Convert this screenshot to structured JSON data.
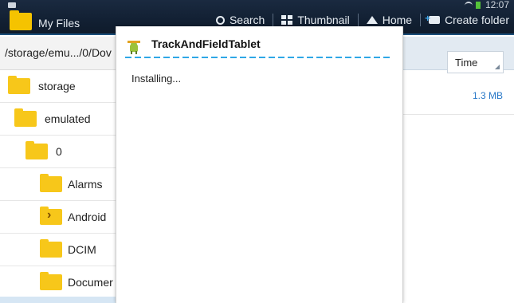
{
  "status": {
    "clock": "12:07"
  },
  "actionbar": {
    "app_title": "My Files",
    "search_label": "Search",
    "thumbnail_label": "Thumbnail",
    "home_label": "Home",
    "create_folder_label": "Create folder"
  },
  "left_pane": {
    "path": "/storage/emu.../0/Dov",
    "tree": [
      {
        "label": "storage"
      },
      {
        "label": "emulated"
      },
      {
        "label": "0"
      },
      {
        "label": "Alarms"
      },
      {
        "label": "Android"
      },
      {
        "label": "DCIM"
      },
      {
        "label": "Documer"
      }
    ]
  },
  "right_pane": {
    "sort_label": "Time",
    "file_size": "1.3 MB"
  },
  "dialog": {
    "title": "TrackAndFieldTablet",
    "message": "Installing..."
  },
  "colors": {
    "actionbar": "#122033",
    "accent": "#2fa7e6",
    "folder": "#f7c71a",
    "link": "#2a79c8"
  },
  "icons": [
    "folder-icon",
    "search-icon",
    "thumbnail-icon",
    "home-icon",
    "create-folder-icon",
    "android-app-icon",
    "wifi-icon",
    "battery-icon"
  ]
}
